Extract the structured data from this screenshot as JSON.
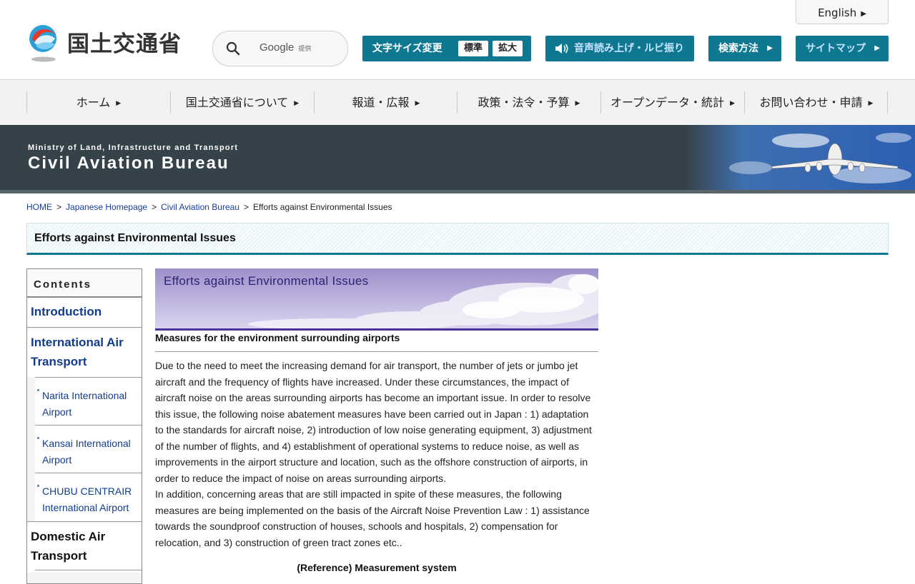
{
  "header": {
    "logo_text": "国土交通省",
    "search_label": "Google",
    "search_sub": "提供",
    "english_label": "English",
    "fontsize_label": "文字サイズ変更",
    "fontsize_standard": "標準",
    "fontsize_large": "拡大",
    "voice_label": "音声読み上げ・ルビ振り",
    "howto_label": "検索方法",
    "sitemap_label": "サイトマップ",
    "accent_color": "#0f7891"
  },
  "nav": [
    {
      "label": "ホーム"
    },
    {
      "label": "国土交通省について"
    },
    {
      "label": "報道・広報"
    },
    {
      "label": "政策・法令・予算"
    },
    {
      "label": "オープンデータ・統計"
    },
    {
      "label": "お問い合わせ・申請"
    }
  ],
  "banner": {
    "subtitle": "Ministry of Land, Infrastructure and Transport",
    "title": "Civil Aviation Bureau"
  },
  "breadcrumb": {
    "home": "HOME",
    "japanese": "Japanese Homepage",
    "cab": "Civil Aviation Bureau",
    "current": "Efforts against Environmental Issues",
    "sep": ">"
  },
  "page_title": "Efforts against Environmental Issues",
  "sidebar": {
    "heading": "Contents",
    "introduction": "Introduction",
    "international": "International Air Transport",
    "sub_items": [
      "Narita International Airport",
      "Kansai International Airport",
      "CHUBU CENTRAIR International Airport"
    ],
    "domestic": "Domestic Air Transport"
  },
  "content": {
    "banner_title": "Efforts against Environmental Issues",
    "heading": "Measures for the environment surrounding airports",
    "paragraph1": "Due to the need to meet the increasing demand for air transport, the number of jets or jumbo jet aircraft and the frequency of flights have increased. Under these circumstances, the impact of aircraft noise on the areas surrounding airports has become an important issue. In order to resolve this issue, the following noise abatement measures have been carried out in Japan : 1) adaptation to the standards for aircraft noise, 2) introduction of low noise generating equipment, 3) adjustment of the number of flights, and 4) establishment of operational systems to reduce noise, as well as improvements in the airport structure and location, such as the offshore construction of airports, in order to reduce the impact of noise on areas surrounding airports.",
    "paragraph2": "In addition, concerning areas that are still impacted in spite of these measures, the following measures are being implemented on the basis of the Aircraft Noise Prevention Law : 1) assistance towards the soundproof construction of houses, schools and hospitals, 2) compensation for relocation, and 3) construction of green tract zones etc..",
    "reference": "(Reference) Measurement system"
  }
}
